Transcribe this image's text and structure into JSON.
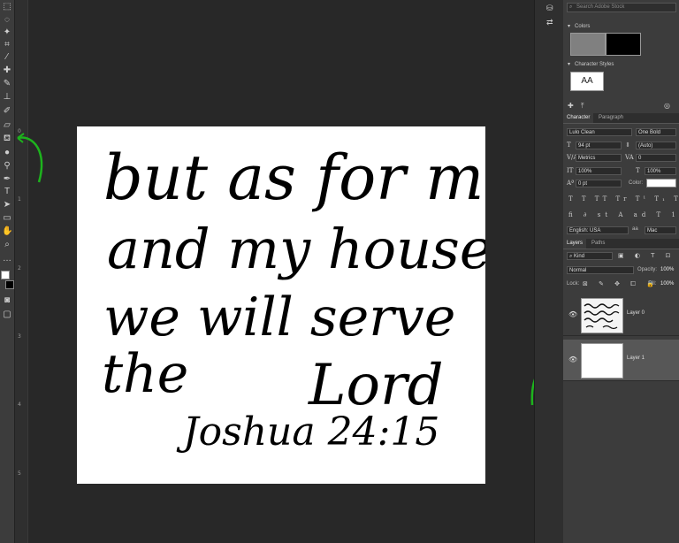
{
  "search": {
    "placeholder": "Search Adobe Stock"
  },
  "colors_panel": {
    "title": "Colors",
    "fg": "#808080",
    "bg": "#000000"
  },
  "character_styles": {
    "title": "Character Styles",
    "sample": "AA"
  },
  "character": {
    "tabs": [
      "Character",
      "Paragraph"
    ],
    "font_family": "Lulo Clean",
    "font_style": "One Bold",
    "size": "94 pt",
    "leading": "(Auto)",
    "kerning": "Metrics",
    "tracking": "0",
    "vscale": "100%",
    "hscale": "100%",
    "baseline": "0 pt",
    "color_label": "Color:",
    "language": "English: USA",
    "antialias": "Mac"
  },
  "layers": {
    "tabs": [
      "Layers",
      "Paths"
    ],
    "kind": "Kind",
    "blend": "Normal",
    "opacity_label": "Opacity:",
    "opacity": "100%",
    "lock_label": "Lock:",
    "fill_label": "Fill:",
    "fill": "100%",
    "items": [
      {
        "name": "Layer 0"
      },
      {
        "name": "Layer 1"
      }
    ]
  },
  "document": {
    "lines": [
      "but as for me",
      "and my house,",
      "we will serve",
      "the",
      "Lord",
      "Joshua 24:15"
    ]
  },
  "ruler": {
    "labels": [
      "0",
      "1",
      "2",
      "3",
      "4",
      "5"
    ]
  },
  "accent": "#1db31d"
}
